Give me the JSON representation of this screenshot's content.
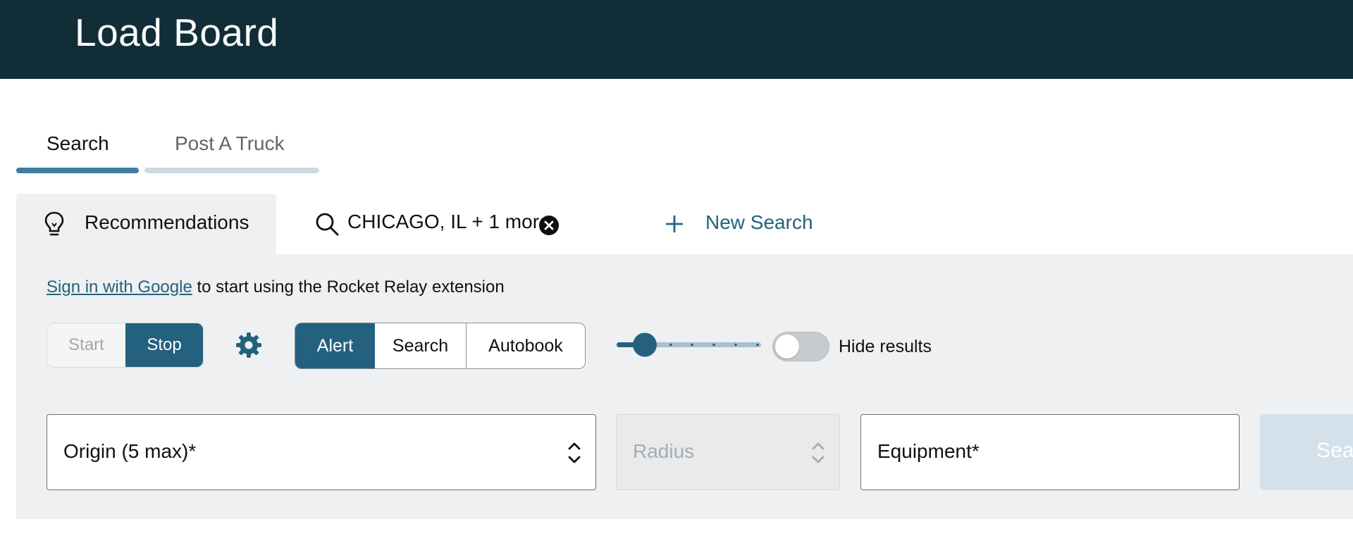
{
  "header": {
    "title": "Load Board"
  },
  "tabs": [
    {
      "label": "Search",
      "active": true
    },
    {
      "label": "Post A Truck",
      "active": false
    }
  ],
  "subtabs": {
    "recommendations": "Recommendations",
    "saved_search": "CHICAGO, IL + 1 more",
    "new_search": "New Search"
  },
  "signin": {
    "link": "Sign in with Google",
    "text": " to start using the Rocket Relay extension"
  },
  "controls": {
    "start": "Start",
    "stop": "Stop",
    "modes": [
      "Alert",
      "Search",
      "Autobook"
    ],
    "active_mode": "Alert",
    "slider_level": 0.2,
    "hide_results_label": "Hide results",
    "hide_results_on": false
  },
  "fields": {
    "origin": "Origin (5 max)*",
    "radius": "Radius",
    "equipment": "Equipment*",
    "search_button": "Search"
  },
  "colors": {
    "header_bg": "#112e38",
    "accent": "#24617f",
    "tab_active": "#3f7ca3",
    "panel_bg": "#eff0f2"
  },
  "icons": {
    "recommendations": "lightbulb-icon",
    "saved_search": "search-icon",
    "remove": "close-circle-icon",
    "new_search": "plus-icon",
    "settings": "gear-icon",
    "select": "chevron-up-down-icon"
  }
}
